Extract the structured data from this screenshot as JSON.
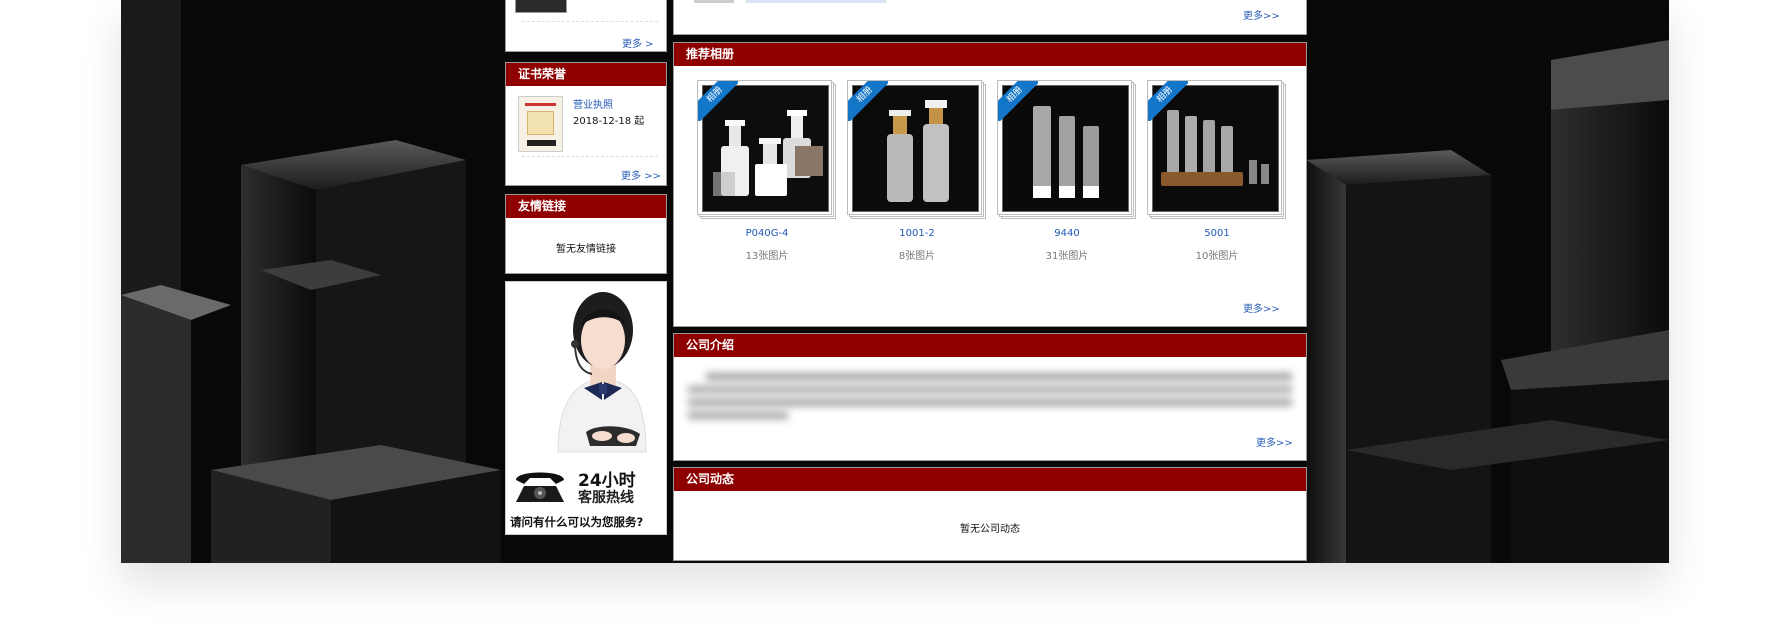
{
  "left_column": {
    "top_more": "更多 >",
    "certificates": {
      "title": "证书荣誉",
      "item_name": "营业执照",
      "item_date": "2018-12-18 起",
      "more": "更多 >>"
    },
    "friend_links": {
      "title": "友情链接",
      "empty": "暂无友情链接"
    },
    "hotline": {
      "title_line1": "24小时",
      "title_line2": "客服热线",
      "caption": "请问有什么可以为您服务?"
    }
  },
  "main_column": {
    "top_more": "更多>>",
    "albums": {
      "title": "推荐相册",
      "badge": "相册",
      "items": [
        {
          "name": "P040G-4",
          "count": "13张图片"
        },
        {
          "name": "1001-2",
          "count": "8张图片"
        },
        {
          "name": "9440",
          "count": "31张图片"
        },
        {
          "name": "5001",
          "count": "10张图片"
        }
      ],
      "more": "更多>>"
    },
    "intro": {
      "title": "公司介绍",
      "more": "更多>>"
    },
    "news": {
      "title": "公司动态",
      "empty": "暂无公司动态"
    }
  }
}
